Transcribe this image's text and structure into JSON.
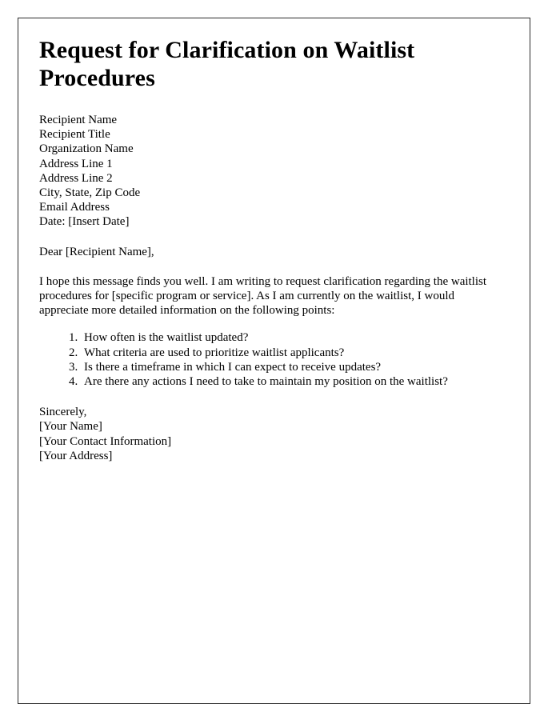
{
  "document": {
    "title": "Request for Clarification on Waitlist Procedures",
    "address_block": [
      "Recipient Name",
      "Recipient Title",
      "Organization Name",
      "Address Line 1",
      "Address Line 2",
      "City, State, Zip Code",
      "Email Address",
      "Date: [Insert Date]"
    ],
    "salutation": "Dear [Recipient Name],",
    "body_paragraph": "I hope this message finds you well. I am writing to request clarification regarding the waitlist procedures for [specific program or service]. As I am currently on the waitlist, I would appreciate more detailed information on the following points:",
    "points": [
      "How often is the waitlist updated?",
      "What criteria are used to prioritize waitlist applicants?",
      "Is there a timeframe in which I can expect to receive updates?",
      "Are there any actions I need to take to maintain my position on the waitlist?"
    ],
    "closing_block": [
      "Sincerely,",
      "[Your Name]",
      "[Your Contact Information]",
      "[Your Address]"
    ]
  },
  "colors": {
    "page_background": "#ffffff",
    "text": "#000000",
    "border": "#2b2b2b"
  }
}
